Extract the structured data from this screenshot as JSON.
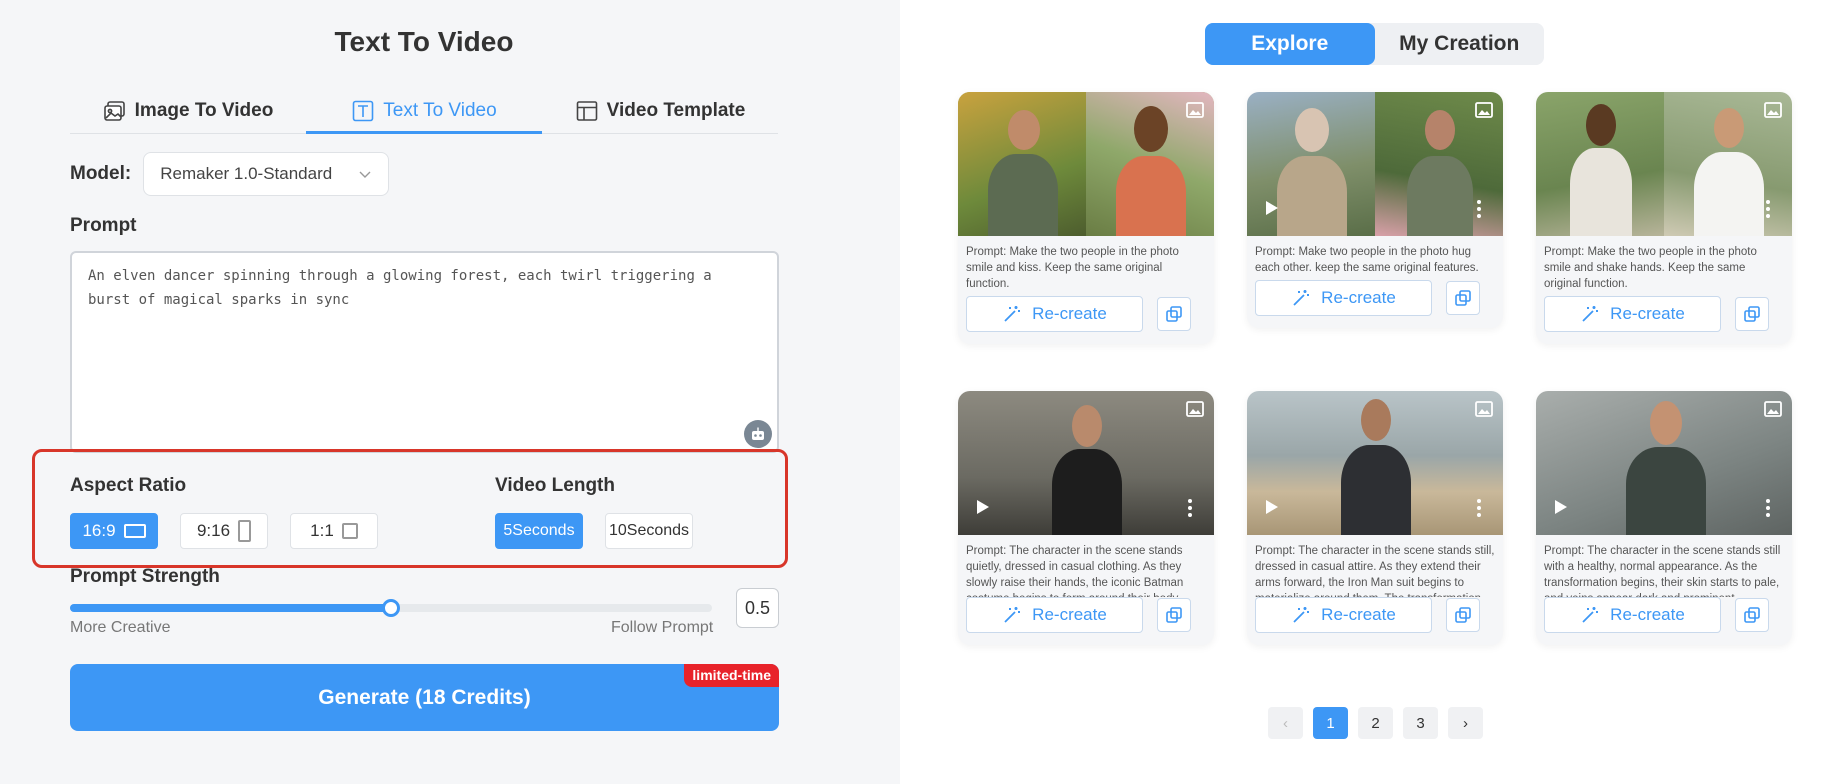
{
  "left_panel": {
    "title": "Text To Video",
    "tabs": [
      {
        "label": "Image To Video",
        "icon": "image-video-icon",
        "active": false
      },
      {
        "label": "Text To Video",
        "icon": "text-icon",
        "active": true
      },
      {
        "label": "Video Template",
        "icon": "template-icon",
        "active": false
      }
    ],
    "model": {
      "label": "Model:",
      "value": "Remaker 1.0-Standard"
    },
    "prompt": {
      "label": "Prompt",
      "value": "An elven dancer spinning through a glowing forest, each twirl triggering a burst of magical sparks in sync"
    },
    "aspect_ratio": {
      "label": "Aspect Ratio",
      "options": [
        "16:9",
        "9:16",
        "1:1"
      ],
      "selected": "16:9"
    },
    "video_length": {
      "label": "Video Length",
      "options": [
        "5Seconds",
        "10Seconds"
      ],
      "selected": "5Seconds"
    },
    "prompt_strength": {
      "label": "Prompt Strength",
      "value": "0.5",
      "fraction": 0.5,
      "left_caption": "More Creative",
      "right_caption": "Follow Prompt"
    },
    "generate": {
      "label": "Generate (18 Credits)",
      "badge": "limited-time"
    }
  },
  "right_panel": {
    "switch": [
      {
        "label": "Explore",
        "active": true
      },
      {
        "label": "My Creation",
        "active": false
      }
    ],
    "recreate_label": "Re-create",
    "cards": [
      {
        "prompt": "Prompt: Make the two people in the photo smile and kiss. Keep the same original function."
      },
      {
        "prompt": "Prompt: Make two people in the photo hug each other. keep the same original features."
      },
      {
        "prompt": "Prompt: Make the two people in the photo smile and shake hands. Keep the same original function."
      },
      {
        "prompt": "Prompt: The character in the scene stands quietly, dressed in casual clothing. As they slowly raise their hands, the iconic Batman costume begins to form around their body. Th..."
      },
      {
        "prompt": "Prompt: The character in the scene stands still, dressed in casual attire. As they extend their arms forward, the Iron Man suit begins to materialize around them. The transformation..."
      },
      {
        "prompt": "Prompt: The character in the scene stands still with a healthy, normal appearance. As the transformation begins, their skin starts to pale, and veins appear dark and prominent..."
      }
    ],
    "pagination": {
      "prev": "‹",
      "pages": [
        "1",
        "2",
        "3"
      ],
      "current": "1",
      "next": "›"
    }
  },
  "colors": {
    "accent": "#3d97f5",
    "highlight": "#d8362a",
    "badge": "#e8232a"
  }
}
